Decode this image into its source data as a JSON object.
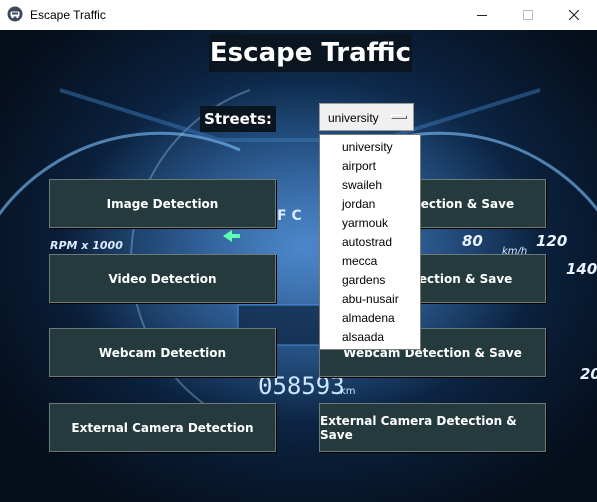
{
  "window": {
    "title": "Escape Traffic",
    "controls": {
      "minimize": "—",
      "maximize": "☐",
      "close": "✕"
    }
  },
  "app": {
    "heading": "Escape Traffic",
    "streets_label": "Streets:",
    "streets_select": {
      "selected": "university",
      "options": [
        "university",
        "airport",
        "swaileh",
        "jordan",
        "yarmouk",
        "autostrad",
        "mecca",
        "gardens",
        "abu-nusair",
        "almadena",
        "alsaada"
      ]
    },
    "buttons_left": [
      "Image Detection",
      "Video Detection",
      "Webcam Detection",
      "External Camera Detection"
    ],
    "buttons_right": [
      "Image Detection & Save",
      "Video Detection & Save",
      "Webcam Detection & Save",
      "External Camera Detection & Save"
    ]
  },
  "background_readouts": {
    "rpm": "RPM x 1000",
    "odometer": "058593",
    "odometer_unit": "km",
    "speed_unit": "km/h",
    "speed_ticks": [
      "80",
      "120",
      "140",
      "20"
    ],
    "fuel": "F C"
  },
  "colors": {
    "button_bg": "#243a3c",
    "label_bg": "#0b1520",
    "background": "#0a1f3a"
  }
}
